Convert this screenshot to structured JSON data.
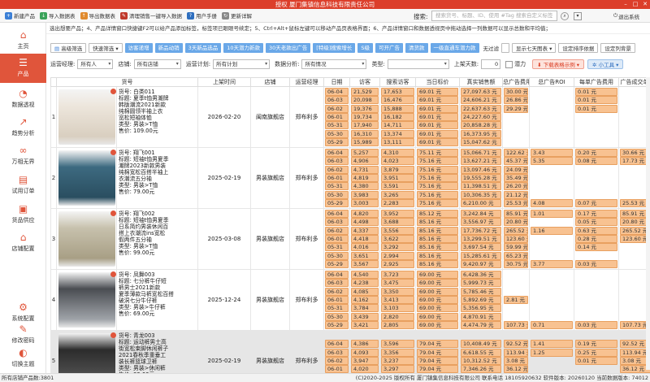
{
  "window": {
    "title": "授权 厦门集镇信息科技有限责任公司"
  },
  "toolbar": {
    "items": [
      {
        "label": "新建产品",
        "icon": "new-icon"
      },
      {
        "label": "导入数据表",
        "icon": "import-icon"
      },
      {
        "label": "导出数据表",
        "icon": "export-icon"
      },
      {
        "label": "清理销售一键导入数据",
        "icon": "clean-icon"
      },
      {
        "label": "用户手册",
        "icon": "manual-icon"
      },
      {
        "label": "更新详解",
        "icon": "update-icon"
      }
    ],
    "search_label": "搜索:",
    "search_placeholder": "搜索货号、标题、ID、使用 #Tag 搜索自定义标签",
    "logout_label": "退出系统"
  },
  "sidebar": {
    "items": [
      {
        "label": "主页",
        "icon": "home-icon"
      },
      {
        "label": "产品",
        "icon": "product-icon",
        "active": true
      },
      {
        "label": "数据透视",
        "icon": "pivot-icon"
      },
      {
        "label": "趋势分析",
        "icon": "trend-icon"
      },
      {
        "label": "万相无界",
        "icon": "infinity-icon"
      },
      {
        "label": "试用订单",
        "icon": "trial-icon"
      },
      {
        "label": "货品供应",
        "icon": "supply-icon"
      },
      {
        "label": "店铺配置",
        "icon": "store-icon"
      }
    ],
    "bottom_items": [
      {
        "label": "系统配置",
        "icon": "settings-icon"
      },
      {
        "label": "修改密码",
        "icon": "password-icon"
      },
      {
        "label": "切换主题",
        "icon": "theme-icon"
      }
    ]
  },
  "notice": "选出想要产品；4、产品详情窗口快捷键F2可以给产品添加标签，标签项已眼眼号续定；5、Ctrl+Alt+鼠标左键可以移动产品页表格界面；6、产品详情窗口和数据透视页中拖动选择一列数据可以显示总数和平均值；",
  "filters": {
    "chips": [
      "高级筛选",
      "快速筛选",
      "访客递增",
      "新品动销",
      "3天新品选品",
      "10天潜力新款",
      "30天老款出广告",
      "[特级]搜索增长",
      "S级",
      "可开广告",
      "清货款",
      "一级直通车潜力款"
    ],
    "no_filter": "无过滤",
    "show_7days": "显示七天图表",
    "sort_settings": "设定排序依据",
    "bg_settings": "设定列背景",
    "ops_label": "运营经理:",
    "ops_value": "所有人",
    "store_label": "店铺:",
    "store_value": "所有店铺",
    "plan_label": "运营计划:",
    "plan_value": "所有计划",
    "analysis_label": "数据分析:",
    "analysis_value": "所有情况",
    "type_label": "类型:",
    "days_label": "上架天数:",
    "days_value": "0",
    "potential_label": "潜力",
    "download_label": "下载表格示例",
    "tools_label": "小工具"
  },
  "table": {
    "headers": [
      "货号",
      "上架时间",
      "店铺",
      "运营经理",
      "日期",
      "访客",
      "搜索访客",
      "当日标价",
      "真实销售额",
      "总广告费用",
      "总广告ROI",
      "每单广告费用",
      "广告成交单价",
      "支付转化"
    ],
    "rows": [
      {
        "idx": "1",
        "info": "货号: 白类011\n标题: 夏季t恤男潮牌\n韩版潮流2021新款\n纯棉圆领半袖上衣\n宽松短袖体恤\n类型: 男装>T恤\n售价: 109.00元",
        "date": "2026-02-20",
        "store": "闽南旗舰店",
        "manager": "郑布利多",
        "dates": [
          "06-04",
          "06-03",
          "06-02",
          "06-01",
          "05-31",
          "05-30",
          "05-29"
        ],
        "visitors": [
          "21,529",
          "20,098",
          "19,376",
          "19,734",
          "17,940",
          "16,310",
          "15,989"
        ],
        "search": [
          "17,653",
          "16,476",
          "15,888",
          "16,182",
          "14,711",
          "13,374",
          "13,111"
        ],
        "price": [
          "69.01 元",
          "69.01 元",
          "69.01 元",
          "69.01 元",
          "69.01 元",
          "69.01 元",
          "69.01 元"
        ],
        "sales": [
          "27,097.63 元",
          "24,606.21 元",
          "22,637.63 元",
          "24,227.60 元",
          "20,858.28 元",
          "16,373.95 元",
          "15,047.62 元"
        ],
        "adfee": [
          "30.00 元",
          "26.86 元",
          "29.29 元",
          "",
          "",
          "",
          ""
        ],
        "roi": [
          "",
          "",
          "",
          "",
          "",
          "",
          ""
        ],
        "perad": [
          "0.01 元",
          "0.01 元",
          "0.01 元",
          "",
          "",
          "",
          ""
        ],
        "adprice": [
          "",
          "",
          "",
          "",
          "",
          "",
          ""
        ]
      },
      {
        "idx": "2",
        "info": "货号: 翔飞001\n标题: 短袖t恤男夏季\n潮牌2023新款男装\n纯棉宽松百搭半袖上\n衣潮流五分袖\n类型: 男装>T恤\n售价: 79.00元",
        "date": "2025-02-19",
        "store": "男装旗舰店",
        "manager": "郑布利多",
        "dates": [
          "06-04",
          "06-03",
          "06-02",
          "06-01",
          "05-31",
          "05-30",
          "05-29"
        ],
        "visitors": [
          "5,257",
          "4,906",
          "4,731",
          "4,819",
          "4,380",
          "3,983",
          "3,003"
        ],
        "search": [
          "4,310",
          "4,023",
          "3,879",
          "3,951",
          "3,591",
          "3,265",
          "2,283"
        ],
        "price": [
          "75.11 元",
          "75.16 元",
          "75.16 元",
          "75.16 元",
          "75.16 元",
          "75.16 元",
          "75.16 元"
        ],
        "sales": [
          "15,066.71 元",
          "13,627.21 元",
          "13,097.46 元",
          "19,555.28 元",
          "11,398.51 元",
          "10,306.35 元",
          "6,210.00 元"
        ],
        "adfee": [
          "122.62 元",
          "45.37 元",
          "24.09 元",
          "35.49 元",
          "26.20 元",
          "21.12 元",
          "25.53 元"
        ],
        "roi": [
          "3.43",
          "5.35",
          "",
          "",
          "",
          "",
          "4.08"
        ],
        "perad": [
          "0.20 元",
          "0.08 元",
          "",
          "",
          "",
          "",
          "0.07 元"
        ],
        "adprice": [
          "30.66 元",
          "17.73 元",
          "",
          "",
          "",
          "",
          "25.53 元"
        ]
      },
      {
        "idx": "3",
        "info": "货号: 翔飞002\n标题: 短袖t恤男夏季\n日系简约男装休闲百\n搭上衣潮流ins宽松\n假两件五分袖\n类型: 男装>T恤\n售价: 99.00元",
        "date": "2025-03-08",
        "store": "男装旗舰店",
        "manager": "郑布利多",
        "dates": [
          "06-04",
          "06-03",
          "06-02",
          "06-01",
          "05-31",
          "05-30",
          "05-29"
        ],
        "visitors": [
          "4,820",
          "4,498",
          "4,337",
          "4,418",
          "4,016",
          "3,651",
          "3,567"
        ],
        "search": [
          "3,952",
          "3,688",
          "3,556",
          "3,622",
          "3,292",
          "2,994",
          "2,925"
        ],
        "price": [
          "85.12 元",
          "85.16 元",
          "85.16 元",
          "85.16 元",
          "85.16 元",
          "85.16 元",
          "85.16 元"
        ],
        "sales": [
          "3,242.84 元",
          "3,556.97 元",
          "17,736.72 元",
          "13,299.51 元",
          "3,697.54 元",
          "15,285.61 元",
          "9,420.97 元"
        ],
        "adfee": [
          "85.91 元",
          "20.80 元",
          "265.52 元",
          "123.60 元",
          "59.99 元",
          "65.23 元",
          "30.75 元"
        ],
        "roi": [
          "1.01",
          "",
          "1.16",
          "",
          "",
          "",
          "3.77"
        ],
        "perad": [
          "0.17 元",
          "0.05 元",
          "0.63 元",
          "0.28 元",
          "0.14 元",
          "",
          "0.03 元"
        ],
        "adprice": [
          "85.91 元",
          "20.80 元",
          "265.52 元",
          "123.60 元",
          "",
          "",
          ""
        ]
      },
      {
        "idx": "4",
        "info": "货号: 凤舞003\n标题: 七分裤牛仔短\n裤男士2021新款\n夏季薄款马裤宽松百搭\n破洞七分牛仔裤\n类型: 男装>牛仔裤\n售价: 69.00元",
        "date": "2025-12-24",
        "store": "男装旗舰店",
        "manager": "郑布利多",
        "dates": [
          "06-04",
          "06-03",
          "06-02",
          "06-01",
          "05-31",
          "05-30",
          "05-29"
        ],
        "visitors": [
          "4,540",
          "4,238",
          "4,085",
          "4,162",
          "3,784",
          "3,439",
          "3,421"
        ],
        "search": [
          "3,723",
          "3,475",
          "3,350",
          "3,413",
          "3,103",
          "2,820",
          "2,805"
        ],
        "price": [
          "69.00 元",
          "69.00 元",
          "69.00 元",
          "69.00 元",
          "69.00 元",
          "69.00 元",
          "69.00 元"
        ],
        "sales": [
          "6,428.36 元",
          "5,999.73 元",
          "5,785.46 元",
          "5,892.69 元",
          "5,356.95 元",
          "4,870.91 元",
          "4,474.79 元"
        ],
        "adfee": [
          "",
          "",
          "",
          "2.81 元",
          "",
          "",
          "107.73 元"
        ],
        "roi": [
          "",
          "",
          "",
          "",
          "",
          "",
          "0.71"
        ],
        "perad": [
          "",
          "",
          "",
          "",
          "",
          "",
          "0.03 元"
        ],
        "adprice": [
          "",
          "",
          "",
          "",
          "",
          "",
          "107.73 元"
        ]
      },
      {
        "idx": "5",
        "info": "货号: 青龙003\n标题: 运动裤男士高\n街宽松束脚休闲裤子\n2021春秋季重垂工\n装长裤篮球卫裤\n类型: 男装>休闲裤\n售价: 89.00元",
        "date": "2025-02-19",
        "store": "男装旗舰店",
        "manager": "郑布利多",
        "dates": [
          "06-04",
          "06-03",
          "06-02",
          "06-01",
          "05-31"
        ],
        "visitors": [
          "4,386",
          "4,093",
          "3,947",
          "4,020",
          "3,655"
        ],
        "search": [
          "3,596",
          "3,356",
          "3,237",
          "3,297",
          "2,997"
        ],
        "price": [
          "79.04 元",
          "79.04 元",
          "79.04 元",
          "79.04 元",
          "79.04 元"
        ],
        "sales": [
          "10,408.49 元",
          "6,618.55 元",
          "10,312.52 元",
          "7,346.26 元",
          "6,780.18 元"
        ],
        "adfee": [
          "92.52 元",
          "113.94 元",
          "3.08 元",
          "36.12 元",
          ""
        ],
        "roi": [
          "1.41",
          "1.25",
          "",
          "",
          ""
        ],
        "perad": [
          "0.19 元",
          "0.25 元",
          "0.01 元",
          "",
          ""
        ],
        "adprice": [
          "92.52 元",
          "113.94 元",
          "3.08 元",
          "36.12 元",
          ""
        ]
      }
    ]
  },
  "statusbar": {
    "left": "所有店铺产品数:3801",
    "right": "(C)2020-2025 版权所有 厦门镇集信息科技有限公司 联系电话 18105920632  软件版本: 20260120  当前数据版本: 74012"
  }
}
